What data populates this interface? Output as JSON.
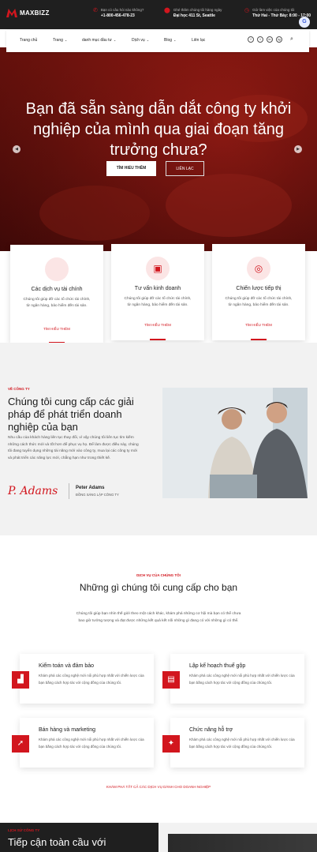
{
  "topbar": {
    "brand": "MAXBIZZ",
    "phone": {
      "label": "Bạn có câu hỏi nào không?",
      "value": "+1-800-456-478-23"
    },
    "address": {
      "label": "Ghé thăm chúng tôi hàng ngày",
      "value": "Đại học 411 St, Seattle"
    },
    "hours": {
      "label": "Giờ làm việc của chúng tôi",
      "value": "Thứ Hai - Thứ Bảy: 8:00 - 17:00"
    },
    "translate_label": "G"
  },
  "nav": {
    "items": [
      "Trang chủ",
      "Trang",
      "danh mục đầu tư",
      "Dịch vụ",
      "Blog",
      "Liên lạc"
    ],
    "caret": "⌄",
    "search": "⌕"
  },
  "hero": {
    "title": "Bạn đã sẵn sàng dẫn dắt công ty khởi nghiệp của mình qua giai đoạn tăng trưởng chưa?",
    "primary_button": "TÌM HIỂU THÊM",
    "secondary_button": "LIÊN LẠC"
  },
  "features": [
    {
      "title": "Các dịch vụ tài chính",
      "text": "Chúng tôi giúp đỡ các tổ chức tài chính, từ ngân hàng, bảo hiểm đến tài sản.",
      "link": "TÌM HIỂU THÊM",
      "icon": "finance-icon"
    },
    {
      "title": "Tư vấn kinh doanh",
      "text": "Chúng tôi giúp đỡ các tổ chức tài chính, từ ngân hàng, bảo hiểm đến tài sản.",
      "link": "TÌM HIỂU THÊM",
      "icon": "presentation-icon"
    },
    {
      "title": "Chiến lược tiếp thị",
      "text": "Chúng tôi giúp đỡ các tổ chức tài chính, từ ngân hàng, bảo hiểm đến tài sản.",
      "link": "TÌM HIỂU THÊM",
      "icon": "target-icon"
    }
  ],
  "about": {
    "eyebrow": "VỀ CÔNG TY",
    "heading": "Chúng tôi cung cấp các giải pháp để phát triển doanh nghiệp của bạn",
    "paragraph": "Nhu cầu của khách hàng liên tục thay đổi, vì vậy chúng tôi liên tục tìm kiếm những cách thức mới và tốt hơn để phục vụ họ. Để làm được điều này, chúng tôi đang tuyển dụng những tài năng mới vào công ty, mua lại các công ty mới và phát triển các năng lực mới, chẳng hạn như trong thiết kế.",
    "signature": "P. Adams",
    "name": "Peter Adams",
    "role": "ĐỒNG SÁNG LẬP CÔNG TY"
  },
  "services": {
    "eyebrow": "DỊCH VỤ CỦA CHÚNG TÔI",
    "heading": "Những gì chúng tôi cung cấp cho bạn",
    "paragraph": "Chúng tôi giúp bạn nhìn thế giới theo một cách khác, khám phá những cơ hội mà bạn có thể chưa bao giờ tưởng tượng và đạt được những kết quả kết nối những gì đang có với những gì có thể.",
    "items": [
      {
        "title": "Kiểm toán và đảm bảo",
        "text": "Khám phá các công nghệ mới nổi phù hợp nhất với chiến lược của bạn bằng cách hợp tác với cộng đồng của chúng tôi.",
        "icon": "chart-icon"
      },
      {
        "title": "Lập kế hoạch thuế gộp",
        "text": "Khám phá các công nghệ mới nổi phù hợp nhất với chiến lược của bạn bằng cách hợp tác với cộng đồng của chúng tôi.",
        "icon": "briefcase-icon"
      },
      {
        "title": "Bán hàng và marketing",
        "text": "Khám phá các công nghệ mới nổi phù hợp nhất với chiến lược của bạn bằng cách hợp tác với cộng đồng của chúng tôi.",
        "icon": "rocket-icon"
      },
      {
        "title": "Chức năng hỗ trợ",
        "text": "Khám phá các công nghệ mới nổi phù hợp nhất với chiến lược của bạn bằng cách hợp tác với cộng đồng của chúng tôi.",
        "icon": "handshake-icon"
      }
    ],
    "all_link": "KHÁM PHÁ TẤT CẢ CÁC DỊCH VỤ DÀNH CHO DOANH NGHIỆP"
  },
  "bottom": {
    "eyebrow": "LỊCH SỬ CÔNG TY",
    "heading": "Tiếp cận toàn cầu với"
  },
  "colors": {
    "accent": "#d2161e",
    "dark": "#1f1f1f"
  }
}
